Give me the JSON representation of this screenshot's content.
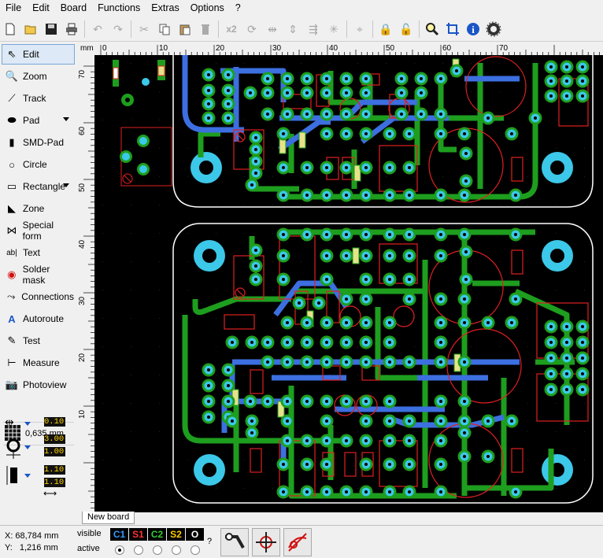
{
  "menu": [
    "File",
    "Edit",
    "Board",
    "Functions",
    "Extras",
    "Options",
    "?"
  ],
  "toolbar": {
    "icons": [
      "new-icon",
      "open-icon",
      "save-icon",
      "print-icon",
      "undo-icon",
      "redo-icon",
      "cut-icon",
      "copy-icon",
      "paste-icon",
      "delete-icon",
      "duplicate-x2-icon",
      "rotate-icon",
      "mirror-horizontal-icon",
      "mirror-vertical-icon",
      "align-icon",
      "group-icon",
      "snap-icon",
      "lock-icon",
      "unlock-icon",
      "zoom-icon",
      "crosshair-icon",
      "info-icon",
      "settings-gear-icon"
    ],
    "dup_label": "x2"
  },
  "tools": [
    {
      "label": "Edit",
      "icon": "pointer-icon",
      "selected": true,
      "arrow": false
    },
    {
      "label": "Zoom",
      "icon": "zoom-icon",
      "selected": false,
      "arrow": false
    },
    {
      "label": "Track",
      "icon": "track-icon",
      "selected": false,
      "arrow": false
    },
    {
      "label": "Pad",
      "icon": "pad-icon",
      "selected": false,
      "arrow": true
    },
    {
      "label": "SMD-Pad",
      "icon": "smd-pad-icon",
      "selected": false,
      "arrow": false
    },
    {
      "label": "Circle",
      "icon": "circle-icon",
      "selected": false,
      "arrow": false
    },
    {
      "label": "Rectangle",
      "icon": "rectangle-icon",
      "selected": false,
      "arrow": true
    },
    {
      "label": "Zone",
      "icon": "zone-icon",
      "selected": false,
      "arrow": false
    },
    {
      "label": "Special form",
      "icon": "special-form-icon",
      "selected": false,
      "arrow": false
    },
    {
      "label": "Text",
      "icon": "text-icon",
      "selected": false,
      "arrow": false
    },
    {
      "label": "Solder mask",
      "icon": "solder-mask-icon",
      "selected": false,
      "arrow": false
    },
    {
      "label": "Connections",
      "icon": "connections-icon",
      "selected": false,
      "arrow": false
    },
    {
      "label": "Autoroute",
      "icon": "autoroute-icon",
      "selected": false,
      "arrow": false
    },
    {
      "label": "Test",
      "icon": "test-icon",
      "selected": false,
      "arrow": false
    },
    {
      "label": "Measure",
      "icon": "measure-icon",
      "selected": false,
      "arrow": false
    },
    {
      "label": "Photoview",
      "icon": "photoview-icon",
      "selected": false,
      "arrow": false
    }
  ],
  "grid": {
    "value": "0,635 mm"
  },
  "params": {
    "track_width": "0.10",
    "pad_outer": "3.00",
    "pad_inner": "1.00",
    "smd_w": "1.10",
    "smd_h": "1.10"
  },
  "ruler": {
    "unit": "mm",
    "top_labels": [
      "0",
      "10",
      "20",
      "30",
      "40",
      "50",
      "60",
      "70"
    ],
    "left_labels": [
      "70",
      "60",
      "50",
      "40",
      "30",
      "20",
      "10"
    ]
  },
  "tab": {
    "label": "New board"
  },
  "status": {
    "x_label": "X:",
    "x_value": "68,784 mm",
    "y_label": "Y:",
    "y_value": "1,216 mm",
    "visible_label": "visible",
    "active_label": "active",
    "question": "?",
    "layers": [
      {
        "name": "C1",
        "color": "#3399ff"
      },
      {
        "name": "S1",
        "color": "#ff3333"
      },
      {
        "name": "C2",
        "color": "#33cc33"
      },
      {
        "name": "S2",
        "color": "#ffcc00"
      },
      {
        "name": "O",
        "color": "#ffffff"
      }
    ]
  },
  "colors": {
    "board_bg": "#000000",
    "copper_top": "#1e9e1e",
    "copper_bottom": "#3c6fe0",
    "pad": "#3cc8e8",
    "silk": "#e02020",
    "outline": "#ffffff"
  }
}
